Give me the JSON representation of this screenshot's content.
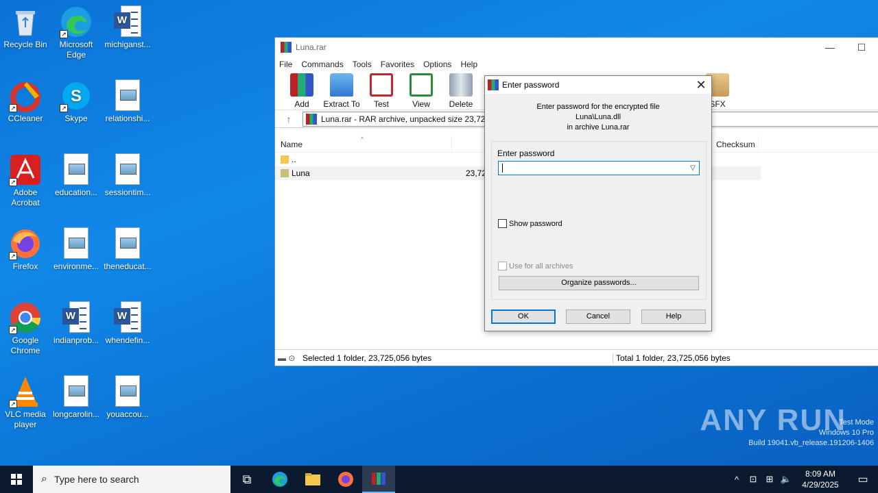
{
  "desktop": {
    "icons": [
      {
        "label": "Recycle Bin",
        "icon": "recycle-bin-icon"
      },
      {
        "label": "Microsoft Edge",
        "icon": "edge-icon"
      },
      {
        "label": "michiganst...",
        "icon": "word-doc-icon"
      },
      {
        "label": "CCleaner",
        "icon": "ccleaner-icon"
      },
      {
        "label": "Skype",
        "icon": "skype-icon"
      },
      {
        "label": "relationshi...",
        "icon": "image-file-icon"
      },
      {
        "label": "Adobe Acrobat",
        "icon": "acrobat-icon"
      },
      {
        "label": "education...",
        "icon": "image-file-icon"
      },
      {
        "label": "sessiontim...",
        "icon": "image-file-icon"
      },
      {
        "label": "Firefox",
        "icon": "firefox-icon"
      },
      {
        "label": "environme...",
        "icon": "image-file-icon"
      },
      {
        "label": "theneducat...",
        "icon": "image-file-icon"
      },
      {
        "label": "Google Chrome",
        "icon": "chrome-icon"
      },
      {
        "label": "indianprob...",
        "icon": "word-doc-icon"
      },
      {
        "label": "whendefin...",
        "icon": "word-doc-icon"
      },
      {
        "label": "VLC media player",
        "icon": "vlc-icon"
      },
      {
        "label": "longcarolin...",
        "icon": "image-file-icon"
      },
      {
        "label": "youaccou...",
        "icon": "image-file-icon"
      }
    ]
  },
  "winrar": {
    "title": "Luna.rar",
    "menu": [
      "File",
      "Commands",
      "Tools",
      "Favorites",
      "Options",
      "Help"
    ],
    "toolbar": [
      "Add",
      "Extract To",
      "Test",
      "View",
      "Delete",
      "SFX"
    ],
    "address": "Luna.rar - RAR archive, unpacked size 23,72",
    "columns": {
      "name": "Name",
      "checksum": "Checksum"
    },
    "rows": [
      {
        "name": "..",
        "size": ""
      },
      {
        "name": "Luna",
        "size": "23,72"
      }
    ],
    "status_left": "Selected 1 folder, 23,725,056 bytes",
    "status_right": "Total 1 folder, 23,725,056 bytes"
  },
  "dialog": {
    "title": "Enter password",
    "message_line1": "Enter password for the encrypted file",
    "message_line2": "Luna\\Luna.dll",
    "message_line3": "in archive Luna.rar",
    "password_label": "Enter password",
    "password_value": "",
    "show_password": "Show password",
    "use_for_all": "Use for all archives",
    "organize": "Organize passwords...",
    "ok": "OK",
    "cancel": "Cancel",
    "help": "Help"
  },
  "watermark": {
    "brand": "ANY RUN",
    "line1": "Test Mode",
    "line2": "Windows 10 Pro",
    "line3": "Build 19041.vb_release.191206-1406"
  },
  "taskbar": {
    "search_placeholder": "Type here to search",
    "time": "8:09 AM",
    "date": "4/29/2025"
  }
}
